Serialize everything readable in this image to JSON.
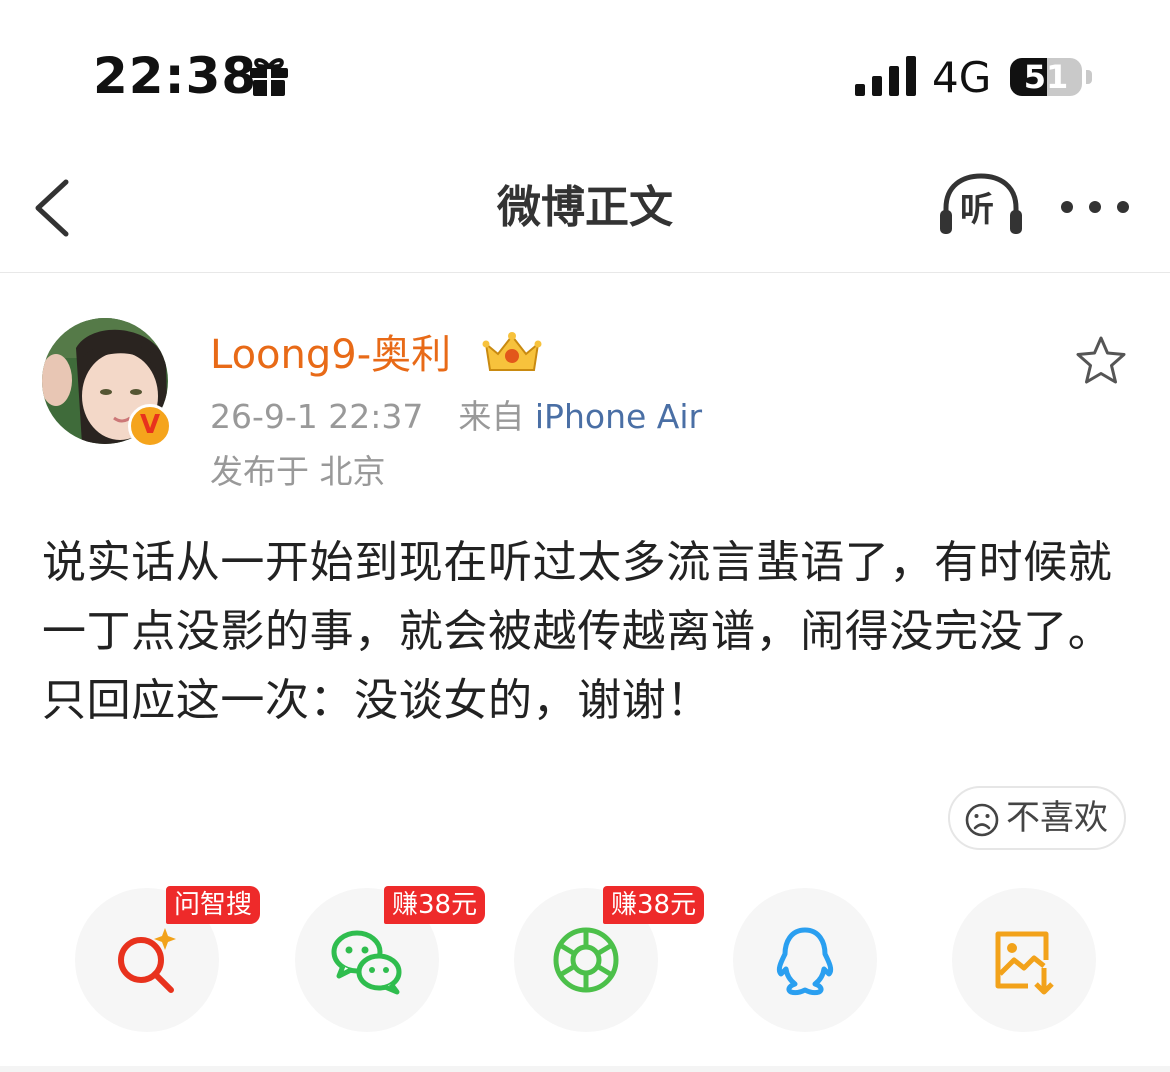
{
  "status_bar": {
    "time": "22:38",
    "network": "4G",
    "battery": "51",
    "battery_level": 0.51
  },
  "nav": {
    "title": "微博正文",
    "listen_label": "听"
  },
  "post": {
    "author": "Loong9-奥利",
    "verified_badge": "V",
    "timestamp": "26-9-1 22:37",
    "source_prefix": "来自",
    "device": "iPhone Air",
    "location": "发布于 北京",
    "text": "说实话从一开始到现在听过太多流言蜚语了，有时候就一丁点没影的事，就会被越传越离谱，闹得没完没了。只回应这一次：没谈女的，谢谢！",
    "dislike_label": "不喜欢"
  },
  "share_bar": {
    "items": [
      {
        "name": "问智搜",
        "tag": "问智搜",
        "icon": "ai-search-icon",
        "color": "#e8321d"
      },
      {
        "name": "微信",
        "tag": "赚38元",
        "icon": "wechat-icon",
        "color": "#2fbd4e"
      },
      {
        "name": "朋友圈",
        "tag": "赚38元",
        "icon": "moments-icon",
        "color": "#4cc04a"
      },
      {
        "name": "QQ",
        "tag": "",
        "icon": "qq-icon",
        "color": "#2a9ff0"
      },
      {
        "name": "保存图片",
        "tag": "",
        "icon": "save-image-icon",
        "color": "#f2a21a"
      }
    ]
  },
  "colors": {
    "username": "#e86a17",
    "source_link": "#4a6fa5",
    "tag_red": "#ee2a2a"
  }
}
